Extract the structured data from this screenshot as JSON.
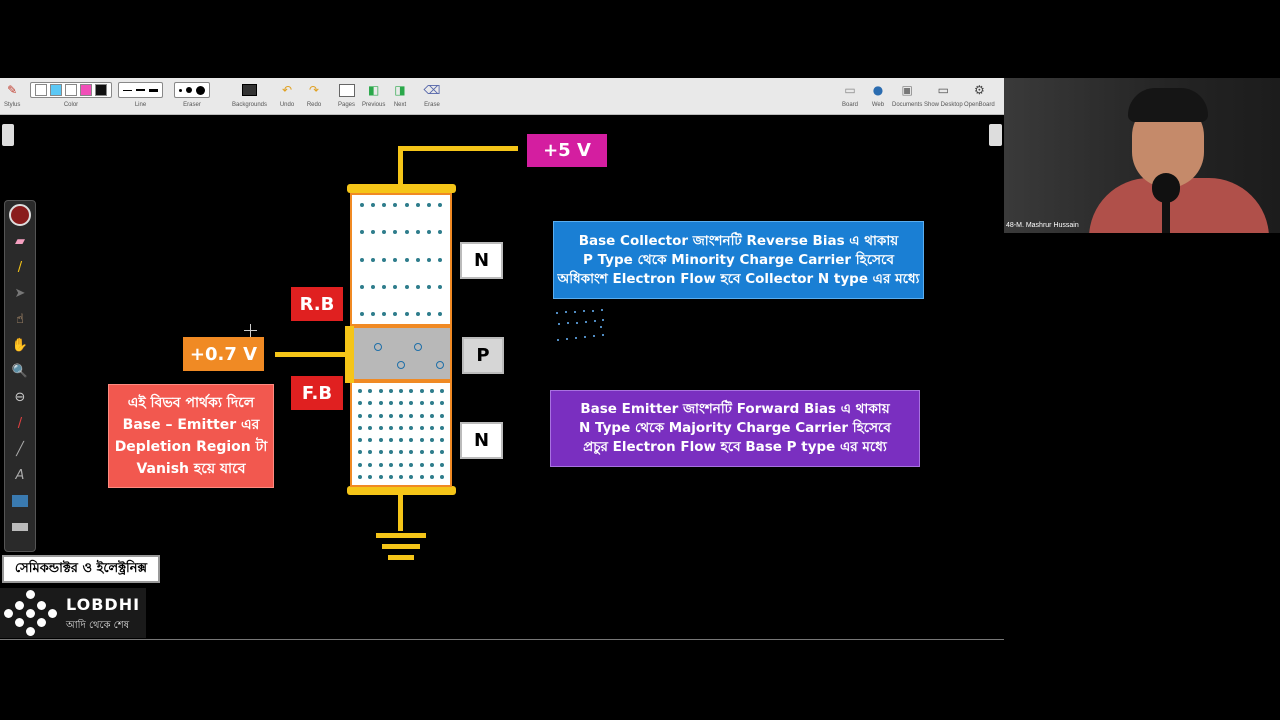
{
  "toolbar": {
    "groups": [
      {
        "id": "stylus",
        "label": "Stylus"
      },
      {
        "id": "color",
        "label": "Color"
      },
      {
        "id": "line",
        "label": "Line"
      },
      {
        "id": "eraser",
        "label": "Eraser"
      },
      {
        "id": "backgrounds",
        "label": "Backgrounds"
      },
      {
        "id": "undo",
        "label": "Undo"
      },
      {
        "id": "redo",
        "label": "Redo"
      },
      {
        "id": "pages",
        "label": "Pages"
      },
      {
        "id": "previous",
        "label": "Previous"
      },
      {
        "id": "next",
        "label": "Next"
      },
      {
        "id": "erase",
        "label": "Erase"
      },
      {
        "id": "board",
        "label": "Board"
      },
      {
        "id": "web",
        "label": "Web"
      },
      {
        "id": "documents",
        "label": "Documents"
      },
      {
        "id": "show_desktop",
        "label": "Show Desktop"
      },
      {
        "id": "openboard",
        "label": "OpenBoard"
      }
    ],
    "colors": [
      "#ffffff",
      "#5bc8f5",
      "#ffffff",
      "#f04fb8",
      "#111111"
    ]
  },
  "diagram": {
    "collector_voltage": "+5 V",
    "base_voltage": "+0.7 V",
    "rb_label": "R.B",
    "fb_label": "F.B",
    "n_top_label": "N",
    "p_label": "P",
    "n_bottom_label": "N",
    "note_red": [
      "এই বিভব পার্থক্য দিলে",
      "Base – Emitter এর",
      "Depletion Region টা",
      "Vanish হয়ে যাবে"
    ],
    "note_blue": [
      "Base Collector জাংশনটি Reverse Bias এ থাকায়",
      "P Type  থেকে Minority Charge Carrier হিসেবে",
      "অধিকাংশ Electron Flow হবে Collector N type এর মধ্যে"
    ],
    "note_purple": [
      "Base Emitter জাংশনটি Forward Bias এ থাকায়",
      "N Type  থেকে Majority Charge Carrier হিসেবে",
      "প্রচুর Electron Flow হবে Base P type এর মধ্যে"
    ],
    "colors": {
      "yellow": "#f5c518",
      "orange": "#f08a24",
      "red": "#e02020",
      "magenta": "#d41ea0",
      "blue": "#1a7fd4",
      "purple": "#7a2fc0",
      "salmon": "#f2584f"
    }
  },
  "branding": {
    "course_title": "সেমিকন্ডাক্টর ও ইলেক্ট্রনিক্স",
    "logo_name": "LOBDHI",
    "logo_tagline": "আদি থেকে শেষ"
  },
  "webcam": {
    "participant_name": "48-M. Mashrur Hussain"
  }
}
